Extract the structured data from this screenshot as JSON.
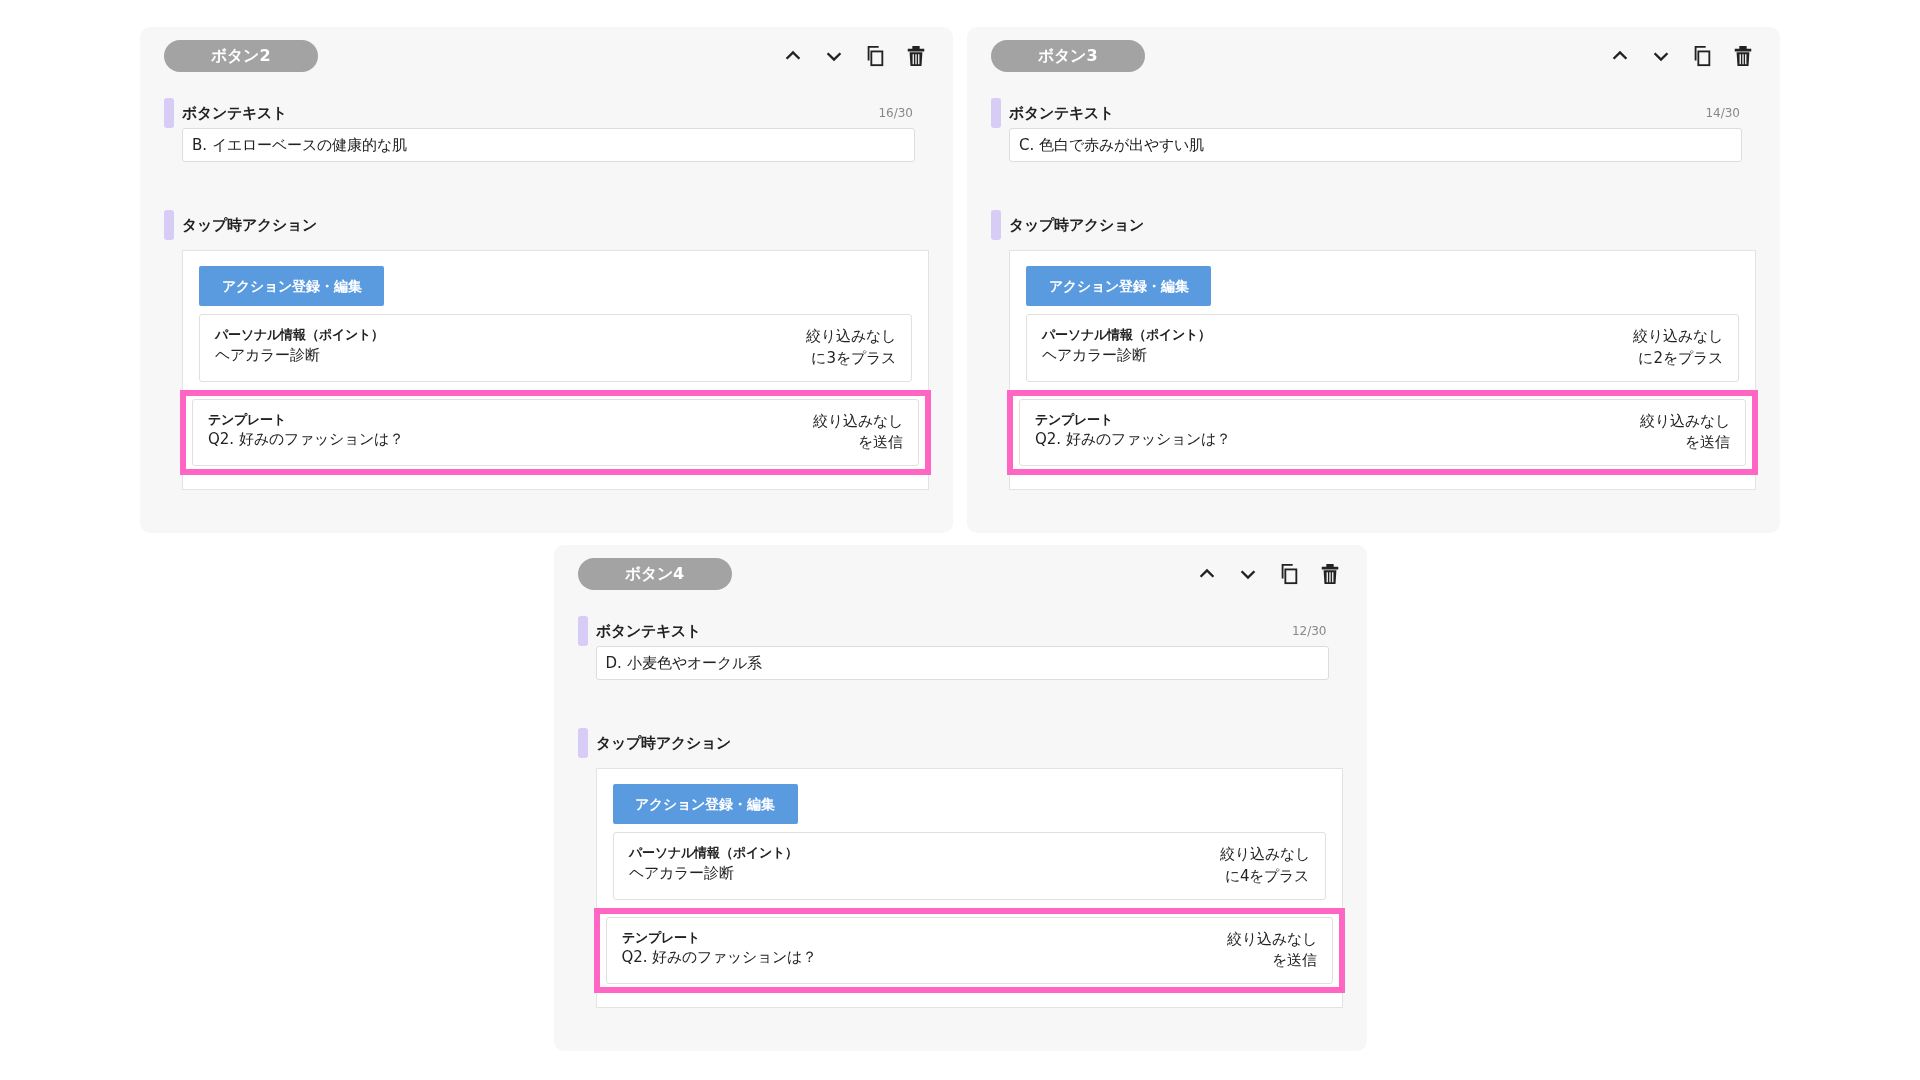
{
  "cards": [
    {
      "title": "ボタン2",
      "text_label": "ボタンテキスト",
      "count": "16/30",
      "value": "B. イエローベースの健康的な肌",
      "action_label": "タップ時アクション",
      "action_button": "アクション登録・編集",
      "actions": [
        {
          "type": "パーソナル情報（ポイント）",
          "name": "ヘアカラー診断",
          "filter": "絞り込みなし",
          "effect": "に3をプラス",
          "highlighted": false
        },
        {
          "type": "テンプレート",
          "name": "Q2. 好みのファッションは？",
          "filter": "絞り込みなし",
          "effect": "を送信",
          "highlighted": true
        }
      ]
    },
    {
      "title": "ボタン3",
      "text_label": "ボタンテキスト",
      "count": "14/30",
      "value": "C. 色白で赤みが出やすい肌",
      "action_label": "タップ時アクション",
      "action_button": "アクション登録・編集",
      "actions": [
        {
          "type": "パーソナル情報（ポイント）",
          "name": "ヘアカラー診断",
          "filter": "絞り込みなし",
          "effect": "に2をプラス",
          "highlighted": false
        },
        {
          "type": "テンプレート",
          "name": "Q2. 好みのファッションは？",
          "filter": "絞り込みなし",
          "effect": "を送信",
          "highlighted": true
        }
      ]
    },
    {
      "title": "ボタン4",
      "text_label": "ボタンテキスト",
      "count": "12/30",
      "value": "D. 小麦色やオークル系",
      "action_label": "タップ時アクション",
      "action_button": "アクション登録・編集",
      "actions": [
        {
          "type": "パーソナル情報（ポイント）",
          "name": "ヘアカラー診断",
          "filter": "絞り込みなし",
          "effect": "に4をプラス",
          "highlighted": false
        },
        {
          "type": "テンプレート",
          "name": "Q2. 好みのファッションは？",
          "filter": "絞り込みなし",
          "effect": "を送信",
          "highlighted": true
        }
      ]
    }
  ]
}
